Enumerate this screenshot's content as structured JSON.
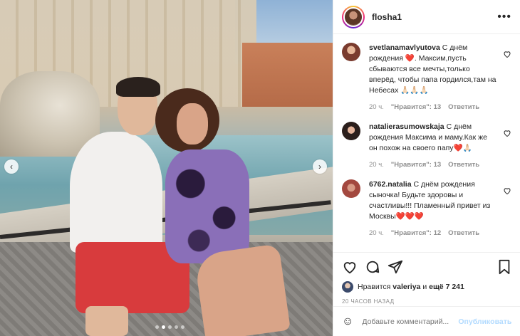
{
  "header": {
    "username": "flosha1",
    "more_icon": "more-horizontal-icon"
  },
  "photo": {
    "prev_icon": "chevron-left-icon",
    "next_icon": "chevron-right-icon",
    "slide_count": 5,
    "active_slide": 1
  },
  "comments": [
    {
      "user": "svetlanamavlyutova",
      "text": "С днём рождения ❤️. Максим,пусть сбываются все мечты,только вперёд, чтобы папа гордился,там на Небесах 🙏🏻🙏🏻🙏🏻",
      "time": "20 ч.",
      "likes": "\"Нравится\": 13",
      "reply": "Ответить",
      "avatar_color": "#7a3b2e"
    },
    {
      "user": "natalierasumowskaja",
      "text": "С днём рождения Максима и маму.Как же он похож на своего папу❤️🙏🏻",
      "time": "20 ч.",
      "likes": "\"Нравится\": 13",
      "reply": "Ответить",
      "avatar_color": "#2b1f1c"
    },
    {
      "user": "6762.natalia",
      "text": "С днём рождения сыночка! Будьте здоровы и счастливы!!! Пламенный привет из Москвы❤️❤️❤️",
      "time": "20 ч.",
      "likes": "\"Нравится\": 12",
      "reply": "Ответить",
      "avatar_color": "#a3483f"
    }
  ],
  "actions": {
    "like_icon": "heart-icon",
    "comment_icon": "comment-icon",
    "share_icon": "share-icon",
    "save_icon": "bookmark-icon"
  },
  "likes": {
    "prefix": "Нравится",
    "user": "valeriya",
    "middle": "и",
    "others": "ещё 7 241"
  },
  "date": "20 ЧАСОВ НАЗАД",
  "add_comment": {
    "placeholder": "Добавьте комментарий...",
    "publish": "Опубликовать",
    "emoji_icon": "smiley-icon"
  }
}
